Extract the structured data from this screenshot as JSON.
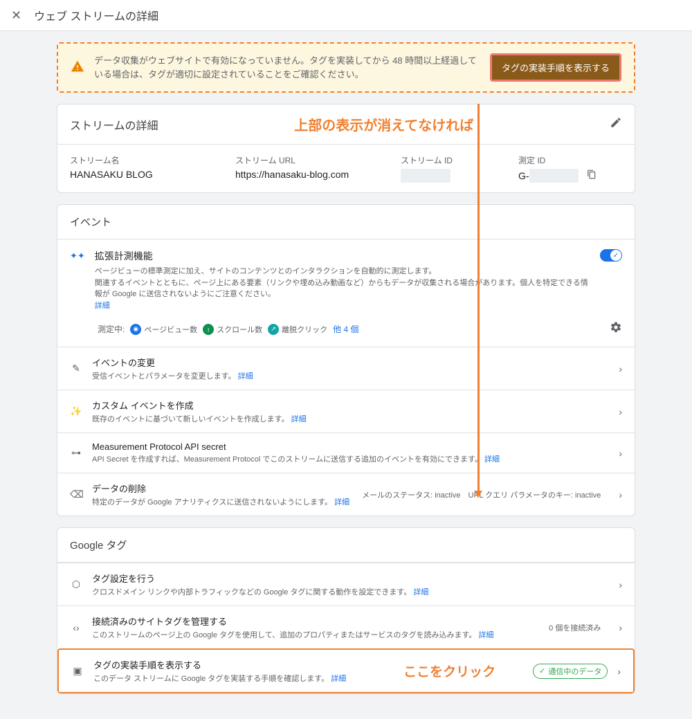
{
  "header": {
    "title": "ウェブ ストリームの詳細"
  },
  "alert": {
    "text": "データ収集がウェブサイトで有効になっていません。タグを実装してから 48 時間以上経過している場合は、タグが適切に設定されていることをご確認ください。",
    "button": "タグの実装手順を表示する"
  },
  "annotation_top": "上部の表示が消えてなければ",
  "annotation_click": "ここをクリック",
  "stream_details": {
    "header": "ストリームの詳細",
    "name_label": "ストリーム名",
    "name_value": "HANASAKU BLOG",
    "url_label": "ストリーム URL",
    "url_value": "https://hanasaku-blog.com",
    "id_label": "ストリーム ID",
    "meas_label": "測定 ID",
    "meas_prefix": "G-"
  },
  "events": {
    "title": "イベント",
    "enhanced": {
      "title": "拡張計測機能",
      "desc1": "ページビューの標準測定に加え、サイトのコンテンツとのインタラクションを自動的に測定します。",
      "desc2": "関連するイベントとともに、ページ上にある要素（リンクや埋め込み動画など）からもデータが収集される場合があります。個人を特定できる情報が Google に送信されないようにご注意ください。",
      "link": "詳細"
    },
    "measuring_label": "測定中:",
    "pill1": "ページビュー数",
    "pill2": "スクロール数",
    "pill3": "離脱クリック",
    "other_count": "他 4 個",
    "rows": [
      {
        "title": "イベントの変更",
        "desc": "受信イベントとパラメータを変更します。",
        "link": "詳細"
      },
      {
        "title": "カスタム イベントを作成",
        "desc": "既存のイベントに基づいて新しいイベントを作成します。",
        "link": "詳細"
      },
      {
        "title": "Measurement Protocol API secret",
        "desc": "API Secret を作成すれば、Measurement Protocol でこのストリームに送信する追加のイベントを有効にできます。",
        "link": "詳細"
      },
      {
        "title": "データの削除",
        "desc": "特定のデータが Google アナリティクスに送信されないようにします。",
        "link": "詳細",
        "right": "メールのステータス: inactive　URL クエリ パラメータのキー: inactive"
      }
    ]
  },
  "google_tag": {
    "title": "Google タグ",
    "rows": [
      {
        "title": "タグ設定を行う",
        "desc": "クロスドメイン リンクや内部トラフィックなどの Google タグに関する動作を設定できます。",
        "link": "詳細"
      },
      {
        "title": "接続済みのサイトタグを管理する",
        "desc": "このストリームのページ上の Google タグを使用して、追加のプロパティまたはサービスのタグを読み込みます。",
        "link": "詳細",
        "right": "0 個を接続済み"
      },
      {
        "title": "タグの実装手順を表示する",
        "desc": "このデータ ストリームに Google タグを実装する手順を確認します。",
        "link": "詳細",
        "badge": "通信中のデータ"
      }
    ]
  }
}
